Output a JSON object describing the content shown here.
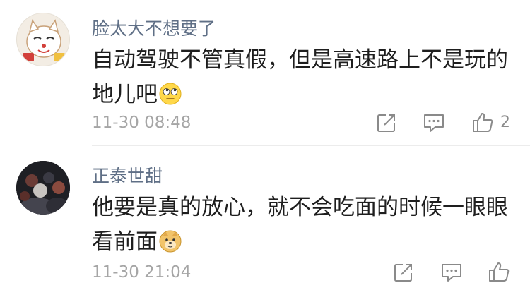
{
  "comments": [
    {
      "username": "脸太大不想要了",
      "text": "自动驾驶不管真假，但是高速路上不是玩的地儿吧",
      "emoji": "eye-roll-emoji",
      "time": "11-30 08:48",
      "like_count": "2"
    },
    {
      "username": "正泰世甜",
      "text": "他要是真的放心，就不会吃面的时候一眼眼看前面",
      "emoji": "doge-emoji",
      "time": "11-30 21:04",
      "like_count": ""
    }
  ],
  "icons": [
    "share-icon",
    "reply-icon",
    "like-icon"
  ],
  "colors": {
    "username": "#5f6f86",
    "text": "#1e1e1e",
    "time": "#a5a5a5",
    "icon": "#8a8a8a"
  }
}
